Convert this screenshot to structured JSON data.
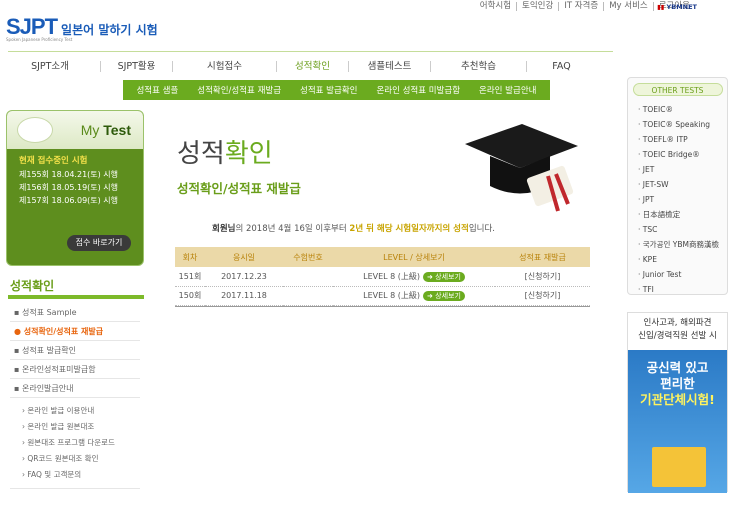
{
  "util": [
    "어학시험",
    "토익인강",
    "IT 자격증",
    "My 서비스",
    "로그아웃"
  ],
  "ybm": "YBMNET",
  "logo": {
    "brand": "SJPT",
    "kr": "일본어 말하기 시험",
    "sub": "Spoken Japanese Proficiency Test"
  },
  "gnb": [
    "SJPT소개",
    "SJPT활용",
    "시험접수",
    "성적확인",
    "샘플테스트",
    "추천학습",
    "FAQ"
  ],
  "subnav": [
    "성적표 샘플",
    "성적확인/성적표 재발급",
    "성적표 발급확인",
    "온라인 성적표 미발급함",
    "온라인 발급안내"
  ],
  "mytest": {
    "title_a": "My ",
    "title_b": "Test",
    "heading": "현재 접수중인 시험",
    "items": [
      "제155회 18.04.21(토) 시행",
      "제156회 18.05.19(토) 시행",
      "제157회 18.06.09(토) 시행"
    ],
    "btn": "접수 바로가기"
  },
  "lnb": {
    "title": "성적확인",
    "items": [
      "성적표 Sample",
      "성적확인/성적표 재발급",
      "성적표 발급확인",
      "온라인성적표미발급함",
      "온라인발급안내"
    ],
    "subs": [
      "온라인 발급 이용안내",
      "온라인 발급 원본대조",
      "원본대조 프로그램 다운로드",
      "QR코드 원본대조 확인",
      "FAQ 및 고객문의"
    ]
  },
  "page": {
    "title_a": "성적",
    "title_b": "확인",
    "subtitle": "성적확인/성적표 재발급"
  },
  "notice": {
    "name": "회원님",
    "mid": "의 2018년 4월 16일 이후부터 ",
    "hl": "2년 뒤 해당 시험일자까지의 성적",
    "end": "입니다."
  },
  "table": {
    "headers": [
      "회차",
      "응시일",
      "수험번호",
      "LEVEL / 상세보기",
      "성적표 재발급"
    ],
    "rows": [
      {
        "no": "151회",
        "date": "2017.12.23",
        "num": "",
        "level": "LEVEL 8 (上級)",
        "detail": "상세보기",
        "reissue": "[신청하기]"
      },
      {
        "no": "150회",
        "date": "2017.11.18",
        "num": "",
        "level": "LEVEL 8 (上級)",
        "detail": "상세보기",
        "reissue": "[신청하기]"
      }
    ]
  },
  "other": {
    "title": "OTHER TESTS",
    "items": [
      "TOEIC®",
      "TOEIC® Speaking",
      "TOEFL® ITP",
      "TOEIC Bridge®",
      "JET",
      "JET-SW",
      "JPT",
      "日本語檢定",
      "TSC",
      "국가공인 YBM商務漢檢",
      "KPE",
      "Junior Test",
      "TFI"
    ]
  },
  "banner": {
    "top1": "인사고과, 해외파견",
    "top2": "신입/경력직원 선발 시",
    "b1": "공신력 있고",
    "b2": "편리한",
    "b3": "기관단체시험!"
  }
}
